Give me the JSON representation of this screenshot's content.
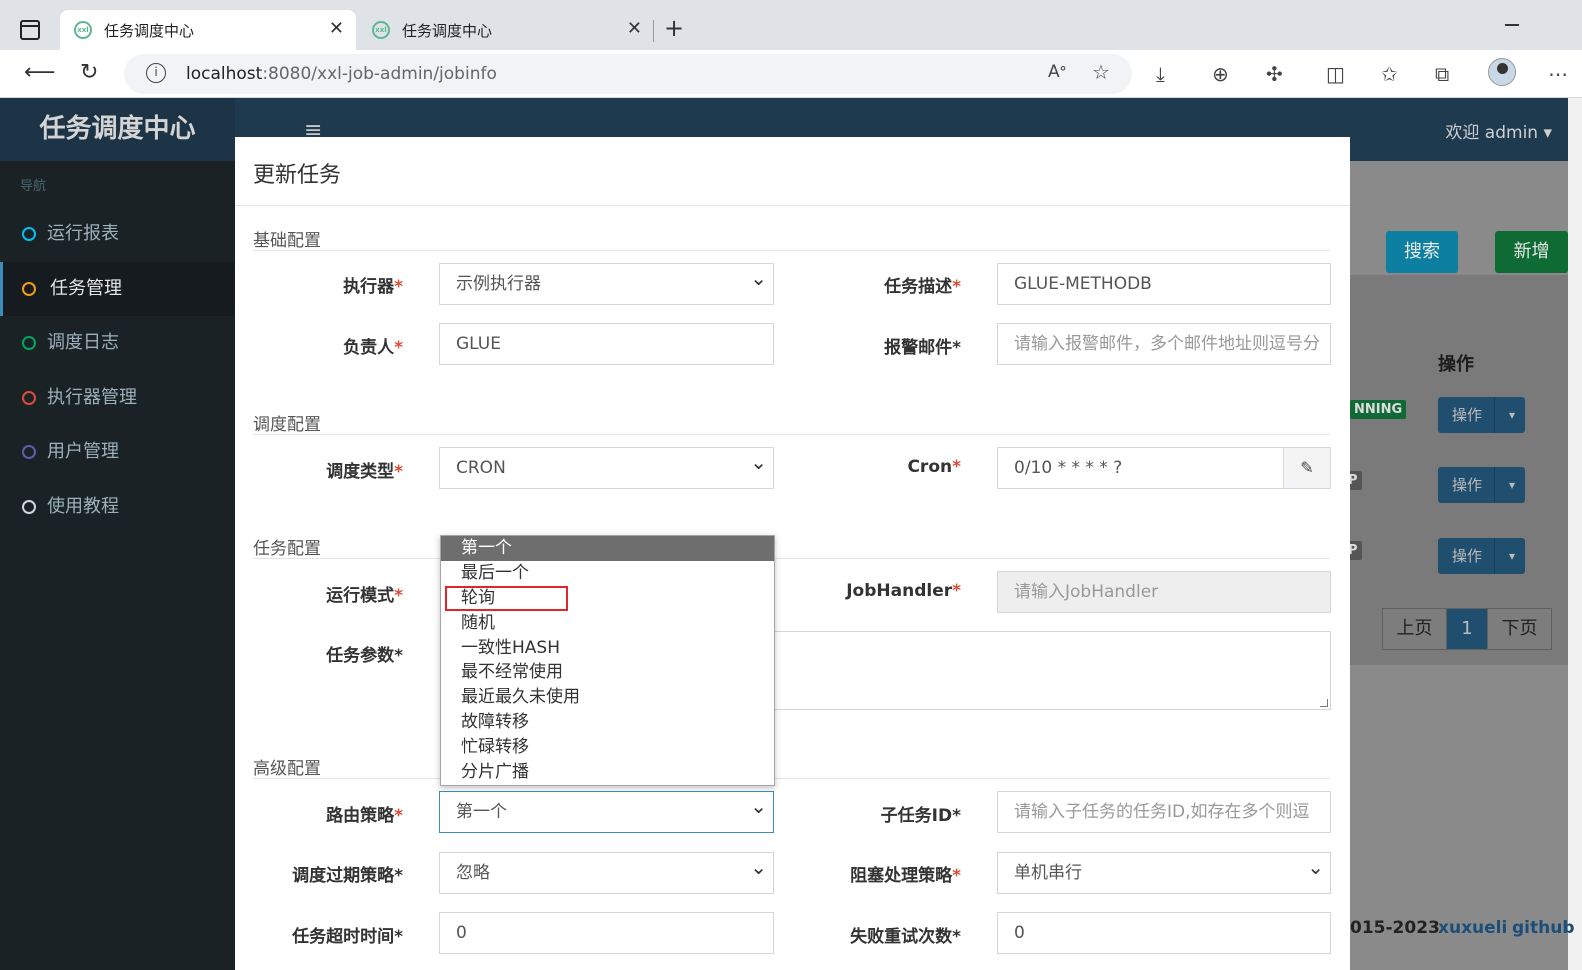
{
  "browser": {
    "tabs": [
      {
        "title": "任务调度中心",
        "favicon": "xxl-favicon",
        "active": true
      },
      {
        "title": "任务调度中心",
        "favicon": "xxl-favicon",
        "active": false
      }
    ],
    "url_host": "localhost",
    "url_rest": ":8080/xxl-job-admin/jobinfo",
    "close_glyph": "✕",
    "newtab_glyph": "+"
  },
  "app": {
    "logo": "任务调度中心",
    "welcome": "欢迎 admin ▾",
    "nav_header": "导航",
    "nav": [
      {
        "label": "运行报表",
        "color": "#00c0ef"
      },
      {
        "label": "任务管理",
        "color": "#f39c12",
        "active": true
      },
      {
        "label": "调度日志",
        "color": "#00a65a"
      },
      {
        "label": "执行器管理",
        "color": "#dd4b39"
      },
      {
        "label": "用户管理",
        "color": "#605ca8"
      },
      {
        "label": "使用教程",
        "color": "#d2d6de"
      }
    ]
  },
  "background": {
    "search_btn": "搜索",
    "add_btn": "新增",
    "col_op": "操作",
    "badges": [
      "NNING",
      "P",
      "P"
    ],
    "op_btn": "操作",
    "pager": {
      "prev": "上页",
      "current": "1",
      "next": "下页"
    },
    "footer": {
      "copy": "015-2023",
      "author": "xuxueli",
      "github": "github"
    }
  },
  "modal": {
    "title": "更新任务",
    "sections": {
      "base": "基础配置",
      "schedule": "调度配置",
      "job": "任务配置",
      "advanced": "高级配置"
    },
    "fields": {
      "executor": {
        "label": "执行器",
        "value": "示例执行器"
      },
      "job_desc": {
        "label": "任务描述",
        "value": "GLUE-METHODB"
      },
      "author": {
        "label": "负责人",
        "value": "GLUE"
      },
      "alarm_email": {
        "label": "报警邮件",
        "placeholder": "请输入报警邮件，多个邮件地址则逗号分"
      },
      "schedule_type": {
        "label": "调度类型",
        "value": "CRON"
      },
      "cron": {
        "label": "Cron",
        "value": "0/10 * * * * ?"
      },
      "glue_type": {
        "label": "运行模式"
      },
      "job_handler": {
        "label": "JobHandler",
        "placeholder": "请输入JobHandler"
      },
      "job_param": {
        "label": "任务参数"
      },
      "route_strategy": {
        "label": "路由策略",
        "value": "第一个"
      },
      "child_job": {
        "label": "子任务ID",
        "placeholder": "请输入子任务的任务ID,如存在多个则逗"
      },
      "misfire": {
        "label": "调度过期策略",
        "value": "忽略"
      },
      "block_strategy": {
        "label": "阻塞处理策略",
        "value": "单机串行"
      },
      "timeout": {
        "label": "任务超时时间",
        "value": "0"
      },
      "fail_retry": {
        "label": "失败重试次数",
        "value": "0"
      }
    },
    "route_options": [
      "第一个",
      "最后一个",
      "轮询",
      "随机",
      "一致性HASH",
      "最不经常使用",
      "最近最久未使用",
      "故障转移",
      "忙碌转移",
      "分片广播"
    ],
    "route_selected": "第一个",
    "highlighted_option": "轮询"
  }
}
